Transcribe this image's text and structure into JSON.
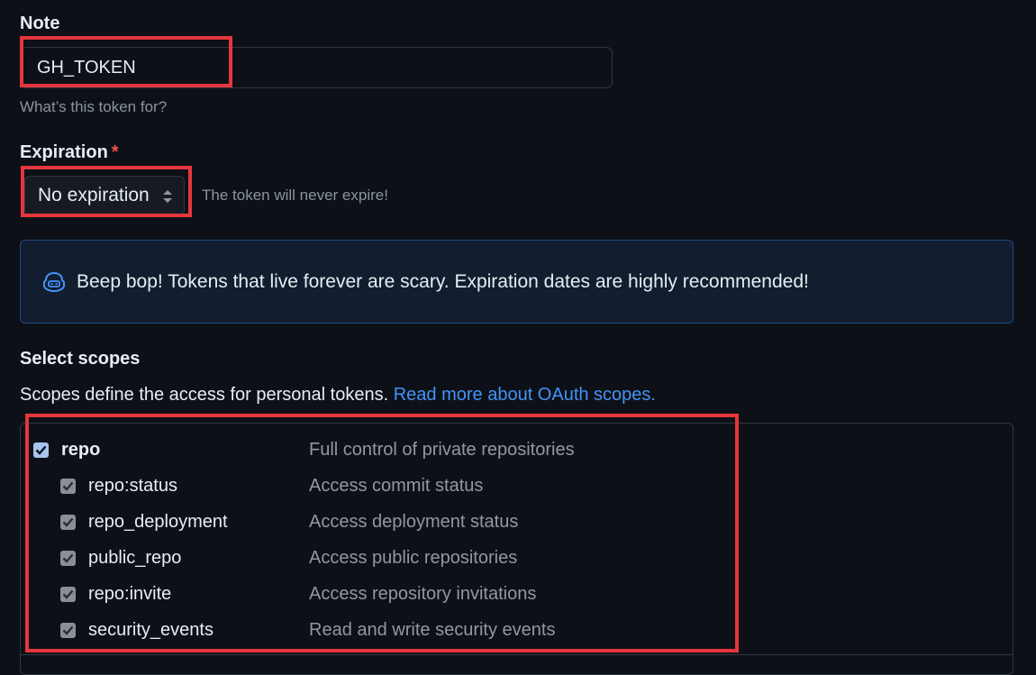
{
  "note": {
    "label": "Note",
    "value": "GH_TOKEN",
    "hint": "What’s this token for?"
  },
  "expiration": {
    "label": "Expiration",
    "required_marker": "*",
    "selected": "No expiration",
    "hint": "The token will never expire!"
  },
  "flash": {
    "icon": "copilot-icon",
    "text": "Beep bop! Tokens that live forever are scary. Expiration dates are highly recommended!"
  },
  "scopes": {
    "title": "Select scopes",
    "description": "Scopes define the access for personal tokens.",
    "link": "Read more about OAuth scopes.",
    "items": [
      {
        "name": "repo",
        "description": "Full control of private repositories",
        "checked": true
      },
      {
        "name": "repo:status",
        "description": "Access commit status",
        "checked": true
      },
      {
        "name": "repo_deployment",
        "description": "Access deployment status",
        "checked": true
      },
      {
        "name": "public_repo",
        "description": "Access public repositories",
        "checked": true
      },
      {
        "name": "repo:invite",
        "description": "Access repository invitations",
        "checked": true
      },
      {
        "name": "security_events",
        "description": "Read and write security events",
        "checked": true
      }
    ]
  },
  "colors": {
    "background": "#0d1117",
    "accent_link": "#4493f8",
    "highlight": "#e5363d",
    "required": "#f85149"
  }
}
